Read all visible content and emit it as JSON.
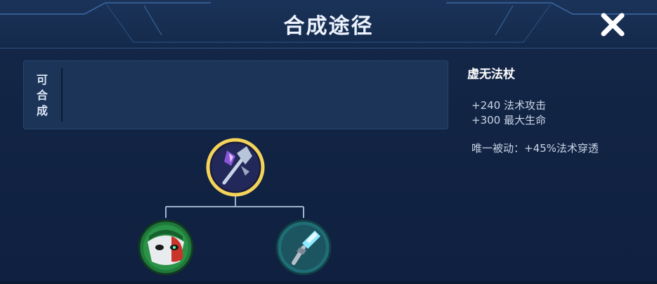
{
  "header": {
    "title": "合成途径",
    "close_icon": "close-x-icon"
  },
  "craftable": {
    "label_chars": [
      "可",
      "合",
      "成"
    ]
  },
  "tree": {
    "root": {
      "icon": "void-staff-icon"
    },
    "children": [
      {
        "icon": "mask-icon"
      },
      {
        "icon": "crystal-wand-icon"
      }
    ]
  },
  "item": {
    "name": "虚无法杖",
    "stats": [
      "+240 法术攻击",
      "+300 最大生命"
    ],
    "passive": "唯一被动：+45%法术穿透"
  },
  "colors": {
    "accent_gold": "#f3d35a",
    "child_green": "#1f7a3a",
    "child_teal": "#1f6e77"
  }
}
